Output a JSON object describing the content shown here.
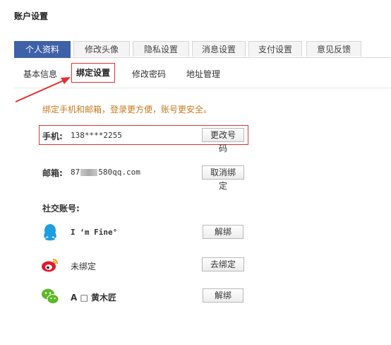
{
  "page": {
    "title": "账户设置"
  },
  "tabs": [
    {
      "label": "个人资料",
      "active": true
    },
    {
      "label": "修改头像"
    },
    {
      "label": "隐私设置"
    },
    {
      "label": "消息设置"
    },
    {
      "label": "支付设置"
    },
    {
      "label": "意见反馈"
    }
  ],
  "subtabs": [
    {
      "label": "基本信息"
    },
    {
      "label": "绑定设置",
      "active": true
    },
    {
      "label": "修改密码"
    },
    {
      "label": "地址管理"
    }
  ],
  "hint": "绑定手机和邮箱，登录更方便，账号更安全。",
  "phone": {
    "label": "手机:",
    "value": "138****2255",
    "button": "更改号码"
  },
  "email": {
    "label": "邮箱:",
    "value_prefix": "87",
    "value_suffix": "580qq.com",
    "button": "取消绑定"
  },
  "social": {
    "title": "社交账号:",
    "qq": {
      "name": "I ‘m Fine°",
      "button": "解绑"
    },
    "weibo": {
      "name": "未绑定",
      "button": "去绑定"
    },
    "wechat": {
      "name": "A □ 黄木匠",
      "button": "解绑"
    }
  },
  "colors": {
    "tab_active": "#3f61a8",
    "hint": "#c87a1e",
    "highlight": "#e03030"
  }
}
